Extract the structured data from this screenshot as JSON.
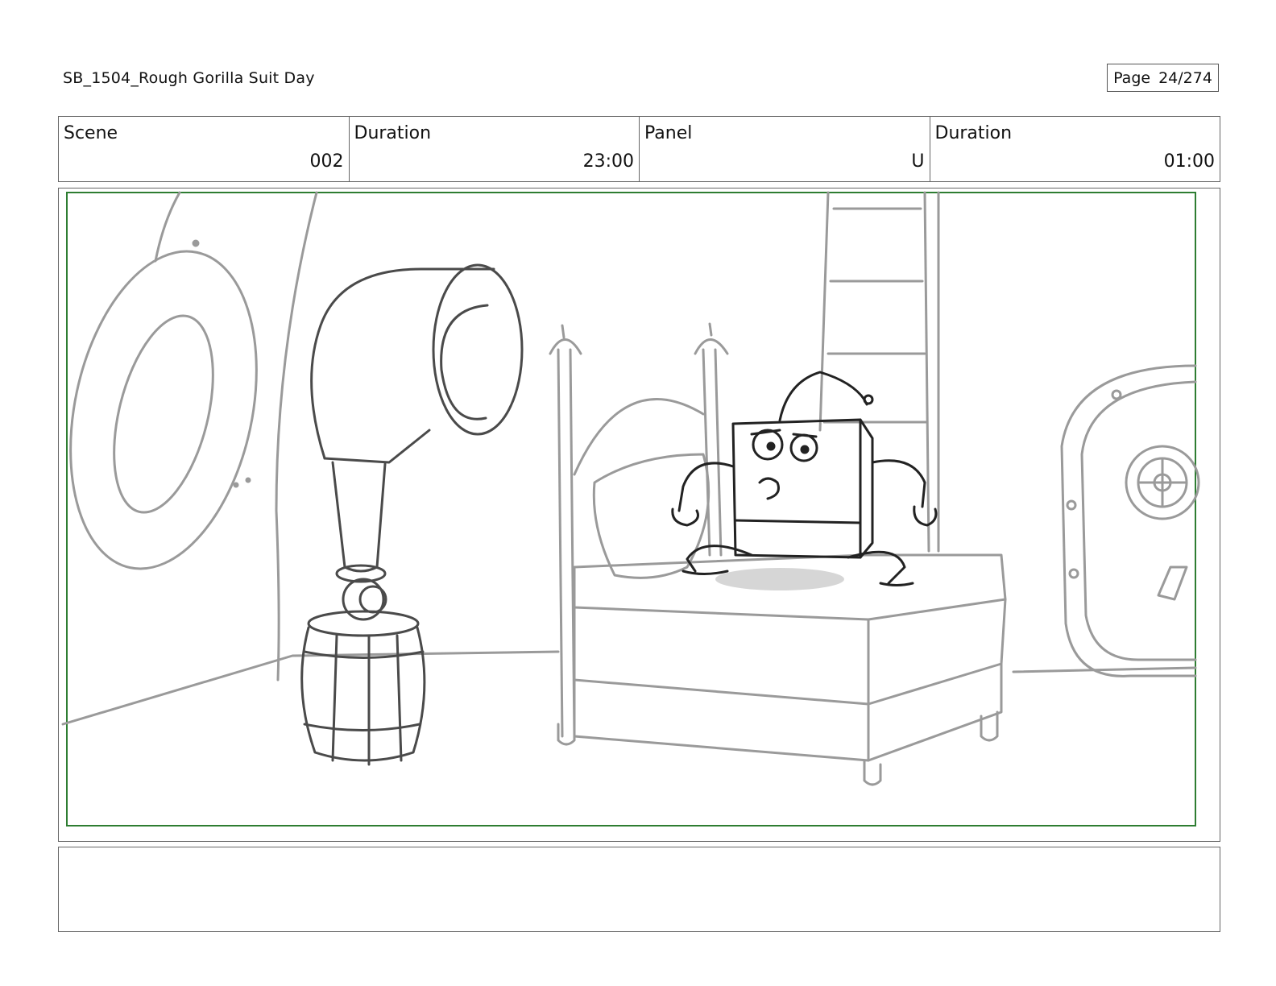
{
  "header": {
    "title": "SB_1504_Rough  Gorilla Suit Day",
    "page_label": "Page",
    "page_number": "24/274"
  },
  "info": {
    "scene_label": "Scene",
    "scene_value": "002",
    "scene_duration_label": "Duration",
    "scene_duration_value": "23:00",
    "panel_label": "Panel",
    "panel_value": "U",
    "panel_duration_label": "Duration",
    "panel_duration_value": "01:00"
  },
  "panel": {
    "safe_frame_color": "#2e7d32",
    "line_color_light": "#9a9a9a",
    "line_color_dark": "#3a3a3a"
  },
  "notes": {
    "text": ""
  }
}
